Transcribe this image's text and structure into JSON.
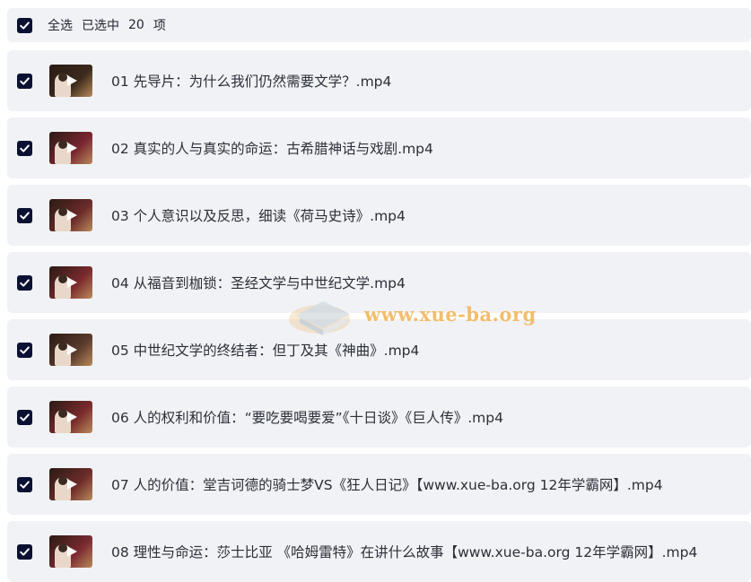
{
  "header": {
    "select_all_label": "全选",
    "selected_prefix": "已选中",
    "selected_count": "20",
    "selected_suffix": "项",
    "checked": true
  },
  "files": [
    {
      "name": "01 先导片：为什么我们仍然需要文学？.mp4",
      "checked": true,
      "thumb_color": "#3b2a1c"
    },
    {
      "name": "02 真实的人与真实的命运：古希腊神话与戏剧.mp4",
      "checked": true,
      "thumb_color": "#7a2630"
    },
    {
      "name": "03 个人意识以及反思，细读《荷马史诗》.mp4",
      "checked": true,
      "thumb_color": "#6b2a2a"
    },
    {
      "name": "04 从福音到枷锁：圣经文学与中世纪文学.mp4",
      "checked": true,
      "thumb_color": "#7c2a2e"
    },
    {
      "name": "05 中世纪文学的终结者：但丁及其《神曲》.mp4",
      "checked": true,
      "thumb_color": "#5a3a2c"
    },
    {
      "name": "06 人的权利和价值：“要吃要喝要爱”《十日谈》《巨人传》.mp4",
      "checked": true,
      "thumb_color": "#7a2a2c"
    },
    {
      "name": "07 人的价值：堂吉诃德的骑士梦VS《狂人日记》【www.xue-ba.org 12年学霸网】.mp4",
      "checked": true,
      "thumb_color": "#6e2c2a"
    },
    {
      "name": "08 理性与命运：莎士比亚 《哈姆雷特》在讲什么故事【www.xue-ba.org 12年学霸网】.mp4",
      "checked": true,
      "thumb_color": "#7c2a30"
    }
  ],
  "watermark": {
    "text": "www.xue-ba.org"
  },
  "colors": {
    "checkbox": "#0b1133",
    "row_background": "#f1f2f5",
    "watermark": "#f2b352"
  }
}
